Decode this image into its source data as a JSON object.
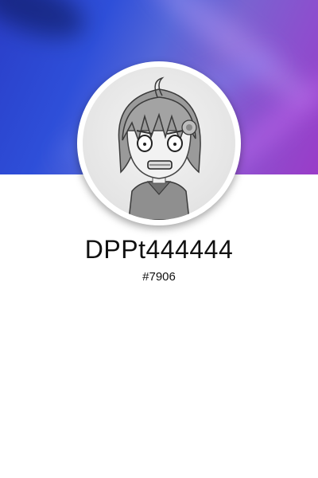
{
  "profile": {
    "username": "DPPt444444",
    "discriminator": "#7906"
  },
  "banner": {
    "colors": [
      "#2a3ec8",
      "#5466d8",
      "#9a3cc8"
    ]
  },
  "avatar": {
    "icon": "anime-character-avatar"
  }
}
